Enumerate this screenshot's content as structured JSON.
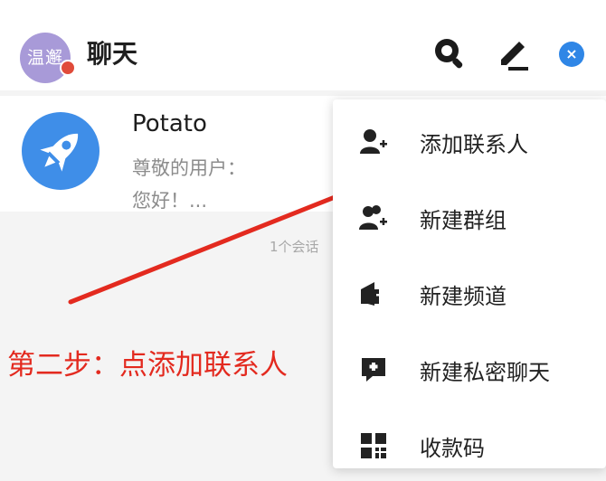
{
  "header": {
    "avatar_text": "温邂",
    "title": "聊天",
    "close_glyph": "×",
    "icons": [
      "search-icon",
      "pen-icon",
      "close-icon"
    ]
  },
  "chat_list": {
    "items": [
      {
        "name": "Potato",
        "preview_line1": "尊敬的用户：",
        "preview_line2": "您好！...",
        "avatar_icon": "rocket-icon"
      }
    ],
    "session_count": "1个会话"
  },
  "menu": {
    "items": [
      {
        "label": "添加联系人",
        "icon": "add-contact-icon"
      },
      {
        "label": "新建群组",
        "icon": "new-group-icon"
      },
      {
        "label": "新建频道",
        "icon": "new-channel-icon"
      },
      {
        "label": "新建私密聊天",
        "icon": "private-chat-icon"
      },
      {
        "label": "收款码",
        "icon": "qr-code-icon"
      }
    ]
  },
  "annotation": {
    "text": "第二步：点添加联系人",
    "color": "#e32a1f"
  },
  "colors": {
    "accent": "#2f86e6",
    "avatar": "#a89ad8",
    "badge": "#e04b3a"
  }
}
